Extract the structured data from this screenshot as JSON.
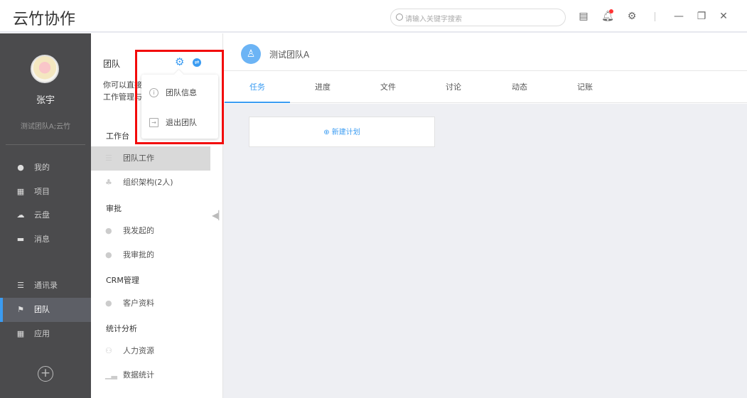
{
  "app": {
    "title": "云竹协作"
  },
  "topbar": {
    "search_placeholder": "请输入关键字搜索"
  },
  "user": {
    "name": "张宇",
    "team": "测试团队A;云竹"
  },
  "nav": [
    {
      "label": "我的"
    },
    {
      "label": "项目"
    },
    {
      "label": "云盘"
    },
    {
      "label": "消息"
    },
    {
      "label": "通讯录"
    },
    {
      "label": "团队"
    },
    {
      "label": "应用"
    }
  ],
  "panel": {
    "title": "团队",
    "desc_line1": "你可以直接",
    "desc_line2": "工作管理与",
    "sections": [
      {
        "title": "工作台",
        "items": [
          "团队工作",
          "组织架构(2人)"
        ]
      },
      {
        "title": "审批",
        "items": [
          "我发起的",
          "我审批的"
        ]
      },
      {
        "title": "CRM管理",
        "items": [
          "客户资料"
        ]
      },
      {
        "title": "统计分析",
        "items": [
          "人力资源",
          "数据统计"
        ]
      }
    ]
  },
  "dropdown": {
    "items": [
      "团队信息",
      "退出团队"
    ]
  },
  "main": {
    "team_name": "测试团队A",
    "tabs": [
      "任务",
      "进度",
      "文件",
      "讨论",
      "动态",
      "记账"
    ],
    "active_tab": "任务",
    "new_plan": "新建计划"
  },
  "colors": {
    "accent": "#3b9cf2",
    "sidebar": "#4b4b4d",
    "highlight": "#f20a0a"
  }
}
